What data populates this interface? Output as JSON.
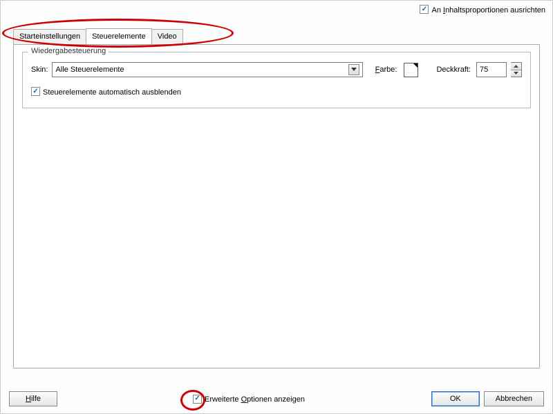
{
  "topbar": {
    "align_label": "An Inhaltsproportionen ausrichten"
  },
  "tabs": {
    "start": "Starteinstellungen",
    "controls": "Steuerelemente",
    "video": "Video"
  },
  "group": {
    "legend": "Wiedergabesteuerung",
    "skin_label": "Skin:",
    "skin_value": "Alle Steuerelemente",
    "color_label": "Farbe:",
    "opacity_label": "Deckkraft:",
    "opacity_value": "75",
    "autohide_label": "Steuerelemente automatisch ausblenden"
  },
  "bottombar": {
    "help_label": "Hilfe",
    "advanced_label": "Erweiterte Optionen anzeigen",
    "ok_label": "OK",
    "cancel_label": "Abbrechen"
  }
}
